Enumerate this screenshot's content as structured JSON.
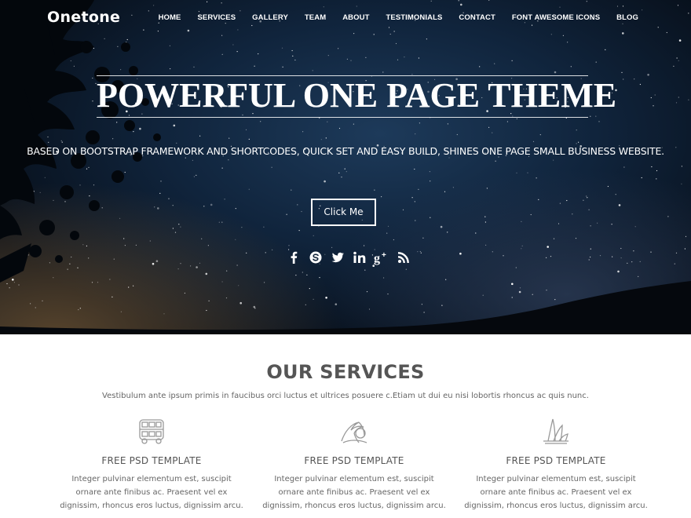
{
  "header": {
    "logo": "Onetone",
    "nav": [
      "HOME",
      "SERVICES",
      "GALLERY",
      "TEAM",
      "ABOUT",
      "TESTIMONIALS",
      "CONTACT",
      "FONT AWESOME ICONS",
      "BLOG"
    ]
  },
  "hero": {
    "title": "POWERFUL ONE PAGE THEME",
    "subtitle": "BASED ON BOOTSTRAP FRAMEWORK AND SHORTCODES, QUICK SET AND EASY BUILD, SHINES ONE PAGE SMALL BUSINESS WEBSITE.",
    "button_label": "Click Me",
    "social_icons": [
      "facebook-icon",
      "skype-icon",
      "twitter-icon",
      "linkedin-icon",
      "google-plus-icon",
      "rss-icon"
    ]
  },
  "services": {
    "title": "OUR SERVICES",
    "description": "Vestibulum ante ipsum primis in faucibus orci luctus et ultrices posuere c.Etiam ut dui eu nisi lobortis rhoncus ac quis nunc.",
    "items": [
      {
        "icon": "bus-icon",
        "title": "FREE PSD TEMPLATE",
        "text": "Integer pulvinar elementum est, suscipit ornare ante finibus ac. Praesent vel ex dignissim, rhoncus eros luctus, dignissim arcu."
      },
      {
        "icon": "palm-tree-icon",
        "title": "FREE PSD TEMPLATE",
        "text": "Integer pulvinar elementum est, suscipit ornare ante finibus ac. Praesent vel ex dignissim, rhoncus eros luctus, dignissim arcu."
      },
      {
        "icon": "opera-house-icon",
        "title": "FREE PSD TEMPLATE",
        "text": "Integer pulvinar elementum est, suscipit ornare ante finibus ac. Praesent vel ex dignissim, rhoncus eros luctus, dignissim arcu."
      }
    ]
  },
  "colors": {
    "hero_background": "#10243c",
    "text_white": "#ffffff",
    "heading_gray": "#555555",
    "body_gray": "#666666",
    "icon_gray": "#999999"
  }
}
